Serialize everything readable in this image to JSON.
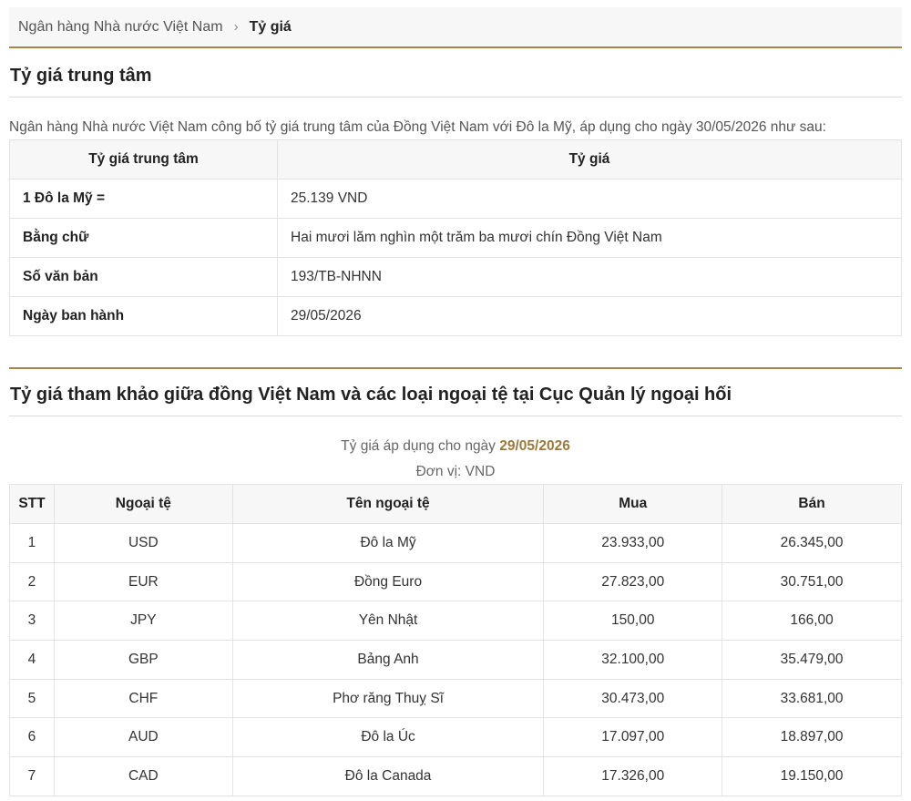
{
  "breadcrumb": {
    "parent": "Ngân hàng Nhà nước Việt Nam",
    "separator": "›",
    "current": "Tỷ giá"
  },
  "central": {
    "title": "Tỷ giá trung tâm",
    "intro": "Ngân hàng Nhà nước Việt Nam công bố tỷ giá trung tâm của Đồng Việt Nam với Đô la Mỹ, áp dụng cho ngày 30/05/2026 như sau:",
    "headers": [
      "Tỷ giá trung tâm",
      "Tỷ giá"
    ],
    "rows": [
      {
        "label": "1 Đô la Mỹ =",
        "value": "25.139 VND"
      },
      {
        "label": "Bằng chữ",
        "value": "Hai mươi lăm nghìn một trăm ba mươi chín Đồng Việt Nam"
      },
      {
        "label": "Số văn bản",
        "value": "193/TB-NHNN"
      },
      {
        "label": "Ngày ban hành",
        "value": "29/05/2026"
      }
    ]
  },
  "reference": {
    "title": "Tỷ giá tham khảo giữa đồng Việt Nam và các loại ngoại tệ tại Cục Quản lý ngoại hối",
    "date_prefix": "Tỷ giá áp dụng cho ngày",
    "date": "29/05/2026",
    "unit": "Đơn vị: VND",
    "headers": [
      "STT",
      "Ngoại tệ",
      "Tên ngoại tệ",
      "Mua",
      "Bán"
    ],
    "rows": [
      {
        "stt": "1",
        "code": "USD",
        "name": "Đô la Mỹ",
        "buy": "23.933,00",
        "sell": "26.345,00"
      },
      {
        "stt": "2",
        "code": "EUR",
        "name": "Đồng Euro",
        "buy": "27.823,00",
        "sell": "30.751,00"
      },
      {
        "stt": "3",
        "code": "JPY",
        "name": "Yên Nhật",
        "buy": "150,00",
        "sell": "166,00"
      },
      {
        "stt": "4",
        "code": "GBP",
        "name": "Bảng Anh",
        "buy": "32.100,00",
        "sell": "35.479,00"
      },
      {
        "stt": "5",
        "code": "CHF",
        "name": "Phơ răng Thuỵ Sĩ",
        "buy": "30.473,00",
        "sell": "33.681,00"
      },
      {
        "stt": "6",
        "code": "AUD",
        "name": "Đô la Úc",
        "buy": "17.097,00",
        "sell": "18.897,00"
      },
      {
        "stt": "7",
        "code": "CAD",
        "name": "Đô la Canada",
        "buy": "17.326,00",
        "sell": "19.150,00"
      }
    ]
  },
  "colors": {
    "accent": "#a9854a",
    "date_highlight": "#9c7a3c",
    "header_bg": "#f7f7f8"
  }
}
